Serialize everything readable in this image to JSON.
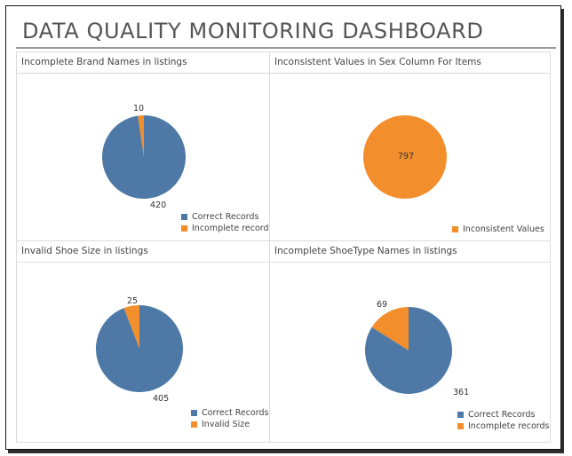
{
  "page_title": "DATA QUALITY MONITORING DASHBOARD",
  "colors": {
    "correct": "#4e79a7",
    "issue": "#f28e2b"
  },
  "panels": [
    {
      "title": "Incomplete Brand Names in listings",
      "slices": [
        {
          "label": "Correct Records",
          "value": 420,
          "color": "#4e79a7"
        },
        {
          "label": "Incomplete records",
          "value": 10,
          "color": "#f28e2b"
        }
      ]
    },
    {
      "title": "Inconsistent Values in Sex Column For Items",
      "slices": [
        {
          "label": "Inconsistent Values",
          "value": 797,
          "color": "#f28e2b"
        }
      ]
    },
    {
      "title": "Invalid Shoe Size in listings",
      "slices": [
        {
          "label": "Correct Records",
          "value": 405,
          "color": "#4e79a7"
        },
        {
          "label": "Invalid Size",
          "value": 25,
          "color": "#f28e2b"
        }
      ]
    },
    {
      "title": "Incomplete ShoeType Names in listings",
      "slices": [
        {
          "label": "Correct Records",
          "value": 361,
          "color": "#4e79a7"
        },
        {
          "label": "Incomplete records",
          "value": 69,
          "color": "#f28e2b"
        }
      ]
    }
  ],
  "chart_data": [
    {
      "type": "pie",
      "title": "Incomplete Brand Names in listings",
      "categories": [
        "Correct Records",
        "Incomplete records"
      ],
      "values": [
        420,
        10
      ]
    },
    {
      "type": "pie",
      "title": "Inconsistent Values in Sex Column For Items",
      "categories": [
        "Inconsistent Values"
      ],
      "values": [
        797
      ]
    },
    {
      "type": "pie",
      "title": "Invalid Shoe Size in listings",
      "categories": [
        "Correct Records",
        "Invalid Size"
      ],
      "values": [
        405,
        25
      ]
    },
    {
      "type": "pie",
      "title": "Incomplete ShoeType Names in listings",
      "categories": [
        "Correct Records",
        "Incomplete records"
      ],
      "values": [
        361,
        69
      ]
    }
  ]
}
